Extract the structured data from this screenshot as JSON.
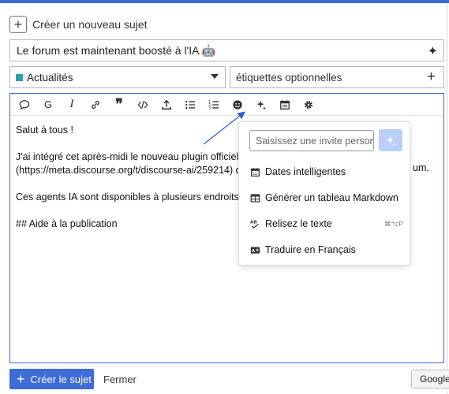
{
  "composer": {
    "create_topic_label": "Créer un nouveau sujet",
    "title_value": "Le forum est maintenant boosté à l'IA 🤖",
    "category": {
      "name": "Actualités",
      "color": "#2aa4a6"
    },
    "tags_placeholder": "étiquettes optionnelles"
  },
  "toolbar": {
    "icons": [
      "chat-bubble-icon",
      "g-icon",
      "italic-icon",
      "link-icon",
      "quote-icon",
      "code-icon",
      "upload-icon",
      "bullet-list-icon",
      "numbered-list-icon",
      "emoji-icon",
      "sparkles-icon",
      "calendar-icon",
      "gear-icon"
    ],
    "italic_glyph": "I",
    "g_glyph": "G"
  },
  "editor": {
    "lines": [
      "Salut à tous !",
      "",
      "J'ai intégré cet après-midi le nouveau plugin officiel [",
      "(https://meta.discourse.org/t/discourse-ai/259214) qu",
      "",
      "Ces agents IA sont disponibles à plusieurs endroits :",
      "",
      "## Aide à la publication"
    ],
    "right_fragment": "um."
  },
  "ai_popup": {
    "prompt_placeholder": "Saisissez une invite personnalisée",
    "items": [
      {
        "label": "Dates intelligentes",
        "icon": "calendar-icon",
        "shortcut": ""
      },
      {
        "label": "Générer un tableau Markdown",
        "icon": "table-icon",
        "shortcut": ""
      },
      {
        "label": "Relisez le texte",
        "icon": "spellcheck-icon",
        "shortcut": "⌘⌥P"
      },
      {
        "label": "Traduire en Français",
        "icon": "translate-icon",
        "shortcut": ""
      }
    ]
  },
  "footer": {
    "submit_label": "Créer le sujet",
    "cancel_label": "Fermer",
    "google_label": "Google"
  },
  "colors": {
    "accent": "#3d6bd8",
    "category": "#2aa4a6"
  }
}
